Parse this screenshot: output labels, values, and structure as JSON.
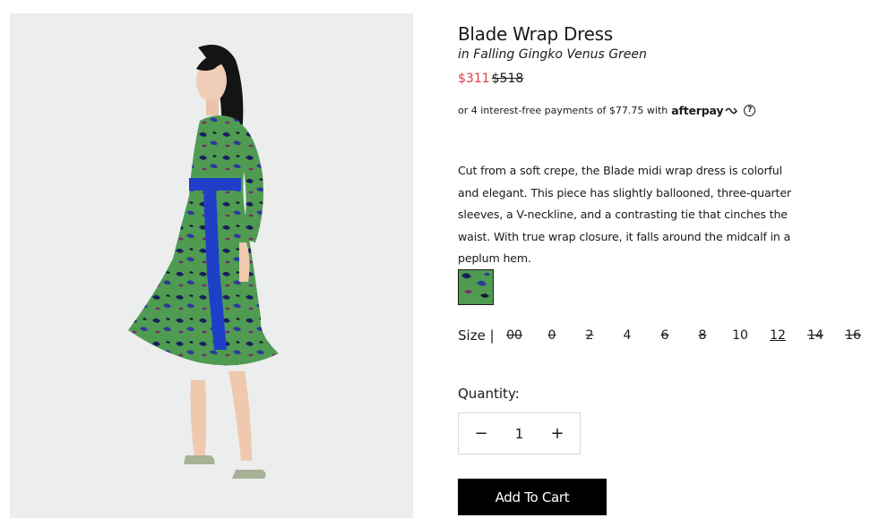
{
  "product": {
    "name": "Blade Wrap Dress",
    "color_name": "in Falling Gingko Venus Green",
    "sale_price": "$311",
    "original_price": "$518",
    "image_alt": "Blade Wrap Dress model photo"
  },
  "afterpay": {
    "text": "or 4 interest-free payments of $77.75 with",
    "logo": "afterpay",
    "icon": "afterpay-arrows-icon",
    "help": "?"
  },
  "description": "Cut from a soft crepe, the Blade midi wrap dress is colorful and elegant. This piece has slightly ballooned, three-quarter sleeves, a V-neckline, and a contrasting tie that cinches the waist. With true wrap closure, it falls around the midcalf in a peplum hem.",
  "swatch": {
    "selected": "Falling Gingko Venus Green"
  },
  "size": {
    "label": "Size |",
    "options": [
      {
        "label": "00",
        "available": false,
        "selected": false
      },
      {
        "label": "0",
        "available": false,
        "selected": false
      },
      {
        "label": "2",
        "available": false,
        "selected": false
      },
      {
        "label": "4",
        "available": true,
        "selected": false
      },
      {
        "label": "6",
        "available": false,
        "selected": false
      },
      {
        "label": "8",
        "available": false,
        "selected": false
      },
      {
        "label": "10",
        "available": true,
        "selected": false
      },
      {
        "label": "12",
        "available": true,
        "selected": true
      },
      {
        "label": "14",
        "available": false,
        "selected": false
      },
      {
        "label": "16",
        "available": false,
        "selected": false
      }
    ]
  },
  "quantity": {
    "label": "Quantity:",
    "value": "1",
    "decrement": "−",
    "increment": "+"
  },
  "cart": {
    "label": "Add To Cart"
  },
  "colors": {
    "sale": "#e63946",
    "dress_green": "#4d9a4f",
    "tie_blue": "#1f3fc8",
    "button_bg": "#000000"
  }
}
